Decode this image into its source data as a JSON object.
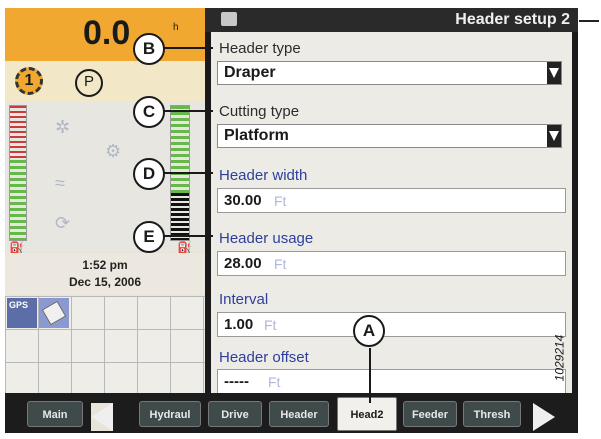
{
  "window": {
    "title": "Header setup 2"
  },
  "status": {
    "speed": "0.0",
    "speed_unit": "h",
    "gear": "1",
    "park": "P",
    "time": "1:52 pm",
    "date": "Dec 15, 2006",
    "gps_label": "GPS"
  },
  "form": {
    "header_type": {
      "label": "Header type",
      "value": "Draper"
    },
    "cutting_type": {
      "label": "Cutting type",
      "value": "Platform"
    },
    "header_width": {
      "label": "Header width",
      "value": "30.00",
      "unit": "Ft"
    },
    "header_usage": {
      "label": "Header usage",
      "value": "28.00",
      "unit": "Ft"
    },
    "interval": {
      "label": "Interval",
      "value": "1.00",
      "unit": "Ft"
    },
    "header_offset": {
      "label": "Header offset",
      "value": "-----",
      "unit": "Ft"
    }
  },
  "tabs": [
    {
      "label": "Main"
    },
    {
      "label": "Hydraul"
    },
    {
      "label": "Drive"
    },
    {
      "label": "Header"
    },
    {
      "label": "Head2",
      "active": true
    },
    {
      "label": "Feeder"
    },
    {
      "label": "Thresh"
    }
  ],
  "callouts": {
    "a": "A",
    "b": "B",
    "c": "C",
    "d": "D",
    "e": "E"
  },
  "figure_ref": "1029214",
  "colors": {
    "accent": "#f0a830",
    "label_blue": "#2e3f9c",
    "unit_gray": "#b0b6d8"
  }
}
